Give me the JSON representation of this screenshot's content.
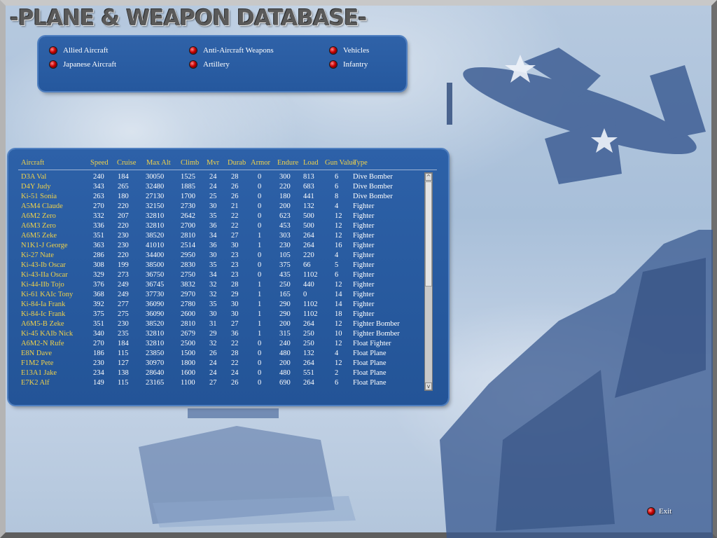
{
  "title": "-PLANE & WEAPON DATABASE-",
  "categories": [
    {
      "label": "Allied Aircraft"
    },
    {
      "label": "Japanese Aircraft"
    },
    {
      "label": "Anti-Aircraft Weapons"
    },
    {
      "label": "Artillery"
    },
    {
      "label": "Vehicles"
    },
    {
      "label": "Infantry"
    }
  ],
  "table": {
    "headers": [
      "Aircraft",
      "Speed",
      "Cruise",
      "Max Alt",
      "Climb",
      "Mvr",
      "Durab",
      "Armor",
      "Endure",
      "Load",
      "Gun Value",
      "Type"
    ],
    "rows": [
      [
        "D3A Val",
        "240",
        "184",
        "30050",
        "1525",
        "24",
        "28",
        "0",
        "300",
        "813",
        "6",
        "Dive Bomber"
      ],
      [
        "D4Y Judy",
        "343",
        "265",
        "32480",
        "1885",
        "24",
        "26",
        "0",
        "220",
        "683",
        "6",
        "Dive Bomber"
      ],
      [
        "Ki-51 Sonia",
        "263",
        "180",
        "27130",
        "1700",
        "25",
        "26",
        "0",
        "180",
        "441",
        "8",
        "Dive Bomber"
      ],
      [
        "A5M4 Claude",
        "270",
        "220",
        "32150",
        "2730",
        "30",
        "21",
        "0",
        "200",
        "132",
        "4",
        "Fighter"
      ],
      [
        "A6M2 Zero",
        "332",
        "207",
        "32810",
        "2642",
        "35",
        "22",
        "0",
        "623",
        "500",
        "12",
        "Fighter"
      ],
      [
        "A6M3 Zero",
        "336",
        "220",
        "32810",
        "2700",
        "36",
        "22",
        "0",
        "453",
        "500",
        "12",
        "Fighter"
      ],
      [
        "A6M5 Zeke",
        "351",
        "230",
        "38520",
        "2810",
        "34",
        "27",
        "1",
        "303",
        "264",
        "12",
        "Fighter"
      ],
      [
        "N1K1-J George",
        "363",
        "230",
        "41010",
        "2514",
        "36",
        "30",
        "1",
        "230",
        "264",
        "16",
        "Fighter"
      ],
      [
        "Ki-27 Nate",
        "286",
        "220",
        "34400",
        "2950",
        "30",
        "23",
        "0",
        "105",
        "220",
        "4",
        "Fighter"
      ],
      [
        "Ki-43-Ib Oscar",
        "308",
        "199",
        "38500",
        "2830",
        "35",
        "23",
        "0",
        "375",
        "66",
        "5",
        "Fighter"
      ],
      [
        "Ki-43-IIa Oscar",
        "329",
        "273",
        "36750",
        "2750",
        "34",
        "23",
        "0",
        "435",
        "1102",
        "6",
        "Fighter"
      ],
      [
        "Ki-44-IIb Tojo",
        "376",
        "249",
        "36745",
        "3832",
        "32",
        "28",
        "1",
        "250",
        "440",
        "12",
        "Fighter"
      ],
      [
        "Ki-61 KAIc Tony",
        "368",
        "249",
        "37730",
        "2970",
        "32",
        "29",
        "1",
        "165",
        "0",
        "14",
        "Fighter"
      ],
      [
        "Ki-84-Ia Frank",
        "392",
        "277",
        "36090",
        "2780",
        "35",
        "30",
        "1",
        "290",
        "1102",
        "14",
        "Fighter"
      ],
      [
        "Ki-84-Ic Frank",
        "375",
        "275",
        "36090",
        "2600",
        "30",
        "30",
        "1",
        "290",
        "1102",
        "18",
        "Fighter"
      ],
      [
        "A6M5-B Zeke",
        "351",
        "230",
        "38520",
        "2810",
        "31",
        "27",
        "1",
        "200",
        "264",
        "12",
        "Fighter Bomber"
      ],
      [
        "Ki-45 KAIb Nick",
        "340",
        "235",
        "32810",
        "2679",
        "29",
        "36",
        "1",
        "315",
        "250",
        "10",
        "Fighter Bomber"
      ],
      [
        "A6M2-N Rufe",
        "270",
        "184",
        "32810",
        "2500",
        "32",
        "22",
        "0",
        "240",
        "250",
        "12",
        "Float Fighter"
      ],
      [
        "E8N Dave",
        "186",
        "115",
        "23850",
        "1500",
        "26",
        "28",
        "0",
        "480",
        "132",
        "4",
        "Float Plane"
      ],
      [
        "F1M2 Pete",
        "230",
        "127",
        "30970",
        "1800",
        "24",
        "22",
        "0",
        "200",
        "264",
        "12",
        "Float Plane"
      ],
      [
        "E13A1 Jake",
        "234",
        "138",
        "28640",
        "1600",
        "24",
        "24",
        "0",
        "480",
        "551",
        "2",
        "Float Plane"
      ],
      [
        "E7K2 Alf",
        "149",
        "115",
        "23165",
        "1100",
        "27",
        "26",
        "0",
        "690",
        "264",
        "6",
        "Float Plane"
      ]
    ]
  },
  "scrollbar": {
    "up_glyph": "^",
    "down_glyph": "v"
  },
  "exit_label": "Exit",
  "colors": {
    "panel": "#2d61a8",
    "header_text": "#f0d24a",
    "name_text": "#f0d24a",
    "value_text": "#ffffff",
    "led": "#c80000"
  }
}
